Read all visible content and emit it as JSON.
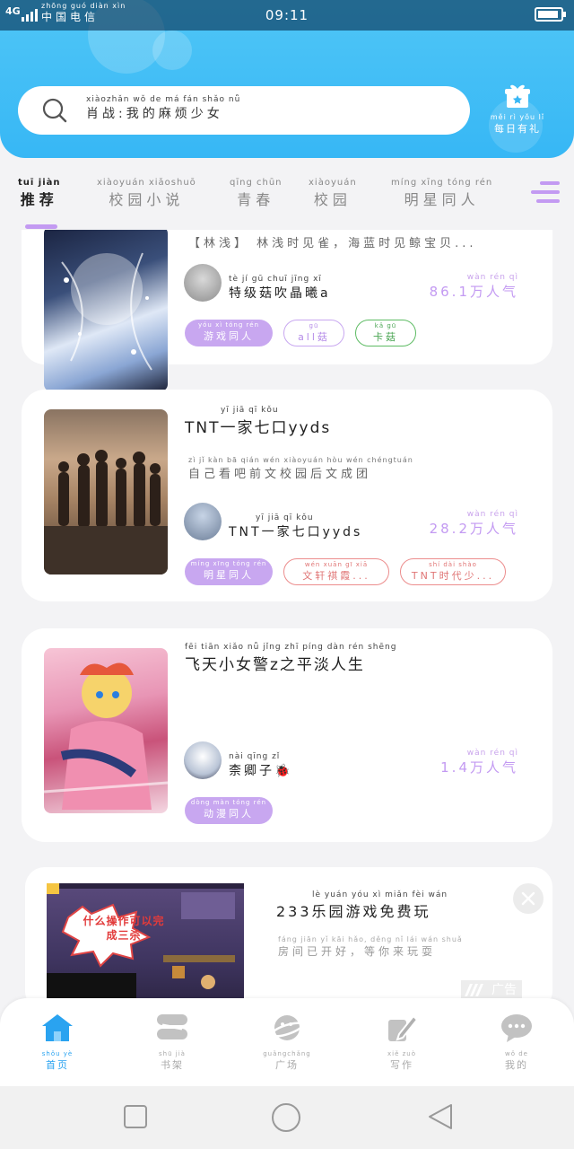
{
  "status_bar": {
    "network": "4G",
    "carrier_pinyin": "zhōng guó diàn xìn",
    "carrier": "中国电信",
    "time": "09:11"
  },
  "search": {
    "pinyin": "xiàozhǎn  wǒ  de  má  fán shǎo  nǚ",
    "placeholder": "肖战:我的麻烦少女"
  },
  "daily_gift": {
    "pinyin": "měi  rì  yǒu  lǐ",
    "label": "每日有礼"
  },
  "tabs": [
    {
      "pinyin": "tuī  jiàn",
      "label": "推荐"
    },
    {
      "pinyin": "xiàoyuán xiǎoshuō",
      "label": "校园小说"
    },
    {
      "pinyin": "qīng chūn",
      "label": "青春"
    },
    {
      "pinyin": "xiàoyuán",
      "label": "校园"
    },
    {
      "pinyin": "míng xīng tóng rén",
      "label": "明星同人"
    }
  ],
  "cards": [
    {
      "desc": "【林浅】 林浅时见雀，海蓝时见鲸宝贝...",
      "author_pinyin": "tè  jí  gū  chuī jīng xī",
      "author": "特级菇吹晶曦a",
      "pop_pinyin": "wàn rén  qì",
      "popularity": "86.1万人气",
      "tags": [
        {
          "pinyin": "yóu  xì  tóng rén",
          "label": "游戏同人"
        },
        {
          "pinyin": "gū",
          "label": "all菇"
        },
        {
          "pinyin": "kǎ  gū",
          "label": "卡菇"
        }
      ]
    },
    {
      "title_pinyin": "yī  jiā  qī  kǒu",
      "title": "TNT一家七口yyds",
      "desc_pinyin": "zì  jǐ  kàn  bā  qián  wén  xiàoyuán  hòu  wén  chéngtuán",
      "desc": "自己看吧前文校园后文成团",
      "author_pinyin": "yī  jiā  qī  kǒu",
      "author": "TNT一家七口yyds",
      "pop_pinyin": "wàn rén  qì",
      "popularity": "28.2万人气",
      "tags": [
        {
          "pinyin": "míng xīng tóng rén",
          "label": "明星同人"
        },
        {
          "pinyin": "wén xuān  gī  xiā",
          "label": "文轩祺霞..."
        },
        {
          "pinyin": "shí  dài  shào",
          "label": "TNT时代少..."
        }
      ]
    },
    {
      "title_pinyin": "fēi  tiān xiǎo  nǚ  jǐng    zhī  píng dàn  rén shēng",
      "title": "飞天小女警z之平淡人生",
      "author_pinyin": "nài qīng  zǐ",
      "author": "柰卿子🐞",
      "pop_pinyin": "wàn rén  qì",
      "popularity": "1.4万人气",
      "tags": [
        {
          "pinyin": "dòng màn tóng rén",
          "label": "动漫同人"
        }
      ]
    }
  ],
  "ad": {
    "image_caption": "什么操作可以完成三杀",
    "title_pinyin": "lè  yuán yóu  xì  miǎn  fèi  wán",
    "title": "233乐园游戏免费玩",
    "desc_pinyin": "fáng jiān  yǐ  kāi  hǎo,   děng  nǐ  lái  wán shuǎ",
    "desc": "房间已开好，等你来玩耍",
    "badge": "广告"
  },
  "bottom_nav": [
    {
      "pinyin": "shǒu  yè",
      "label": "首页"
    },
    {
      "pinyin": "shū  jià",
      "label": "书架"
    },
    {
      "pinyin": "guǎngchǎng",
      "label": "广场"
    },
    {
      "pinyin": "xiě  zuò",
      "label": "写作"
    },
    {
      "pinyin": "wǒ  de",
      "label": "我的"
    }
  ],
  "colors": {
    "header": "#37b7f5",
    "accent_purple": "#c39af2",
    "nav_active": "#2aa3f0"
  }
}
